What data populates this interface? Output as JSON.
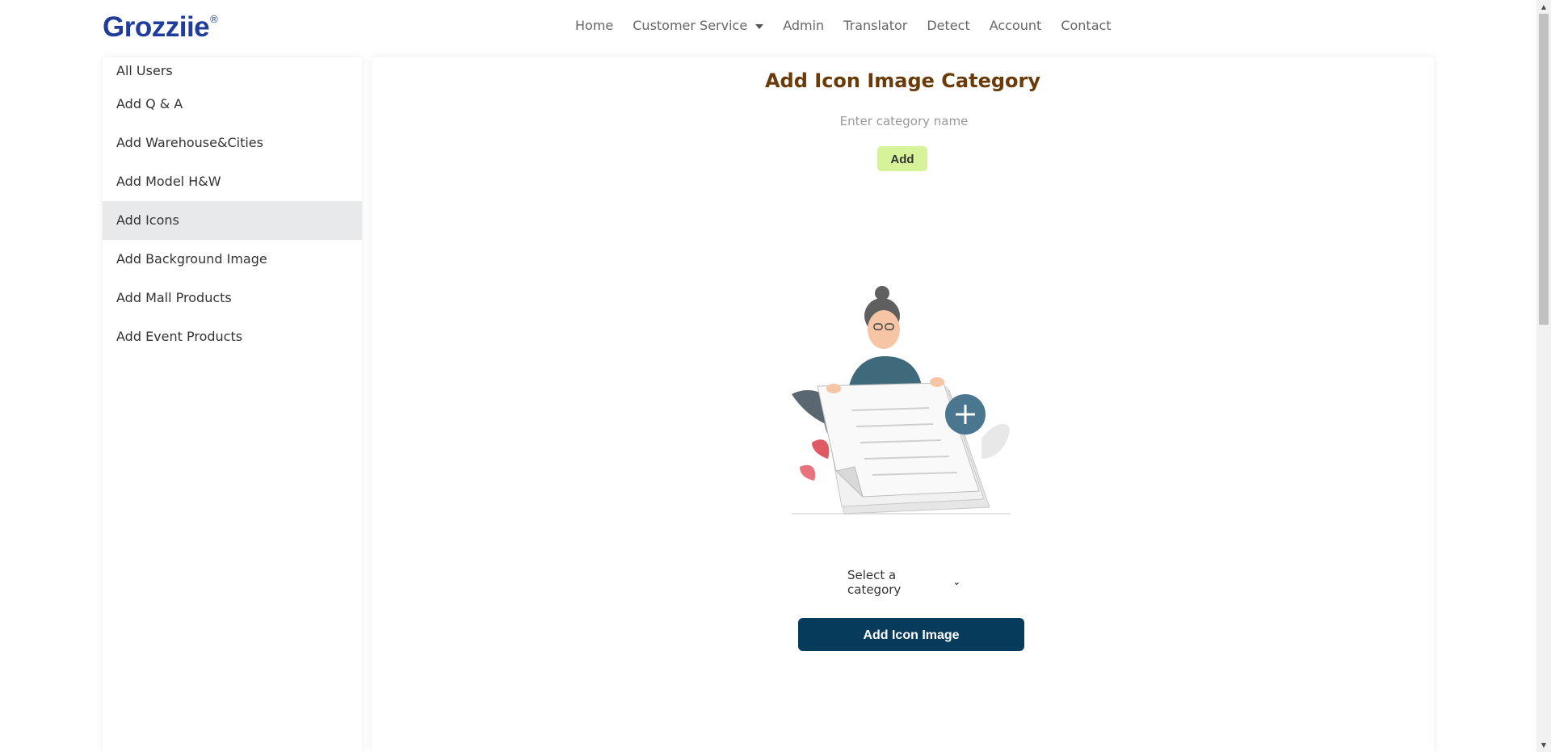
{
  "header": {
    "logo": "Grozziie",
    "logo_mark": "®",
    "nav": [
      {
        "label": "Home"
      },
      {
        "label": "Customer Service",
        "dropdown": true
      },
      {
        "label": "Admin"
      },
      {
        "label": "Translator"
      },
      {
        "label": "Detect"
      },
      {
        "label": "Account"
      },
      {
        "label": "Contact"
      }
    ]
  },
  "sidebar": {
    "items": [
      {
        "label": "All Users"
      },
      {
        "label": "Add Q & A"
      },
      {
        "label": "Add Warehouse&Cities"
      },
      {
        "label": "Add Model H&W"
      },
      {
        "label": "Add Icons",
        "active": true
      },
      {
        "label": "Add Background Image"
      },
      {
        "label": "Add Mall Products"
      },
      {
        "label": "Add Event Products"
      }
    ]
  },
  "main": {
    "title": "Add Icon Image Category",
    "category_input": {
      "placeholder": "Enter category name",
      "value": ""
    },
    "add_button": "Add",
    "illustration_icon": "upload-document-illustration",
    "category_select": {
      "selected": "Select a category"
    },
    "submit_button": "Add Icon Image"
  },
  "colors": {
    "logo": "#1f3d99",
    "title": "#6a3b08",
    "add_button_bg": "#d6f39a",
    "submit_bg": "#063b5c",
    "active_sidebar_bg": "#e8e9eb"
  }
}
